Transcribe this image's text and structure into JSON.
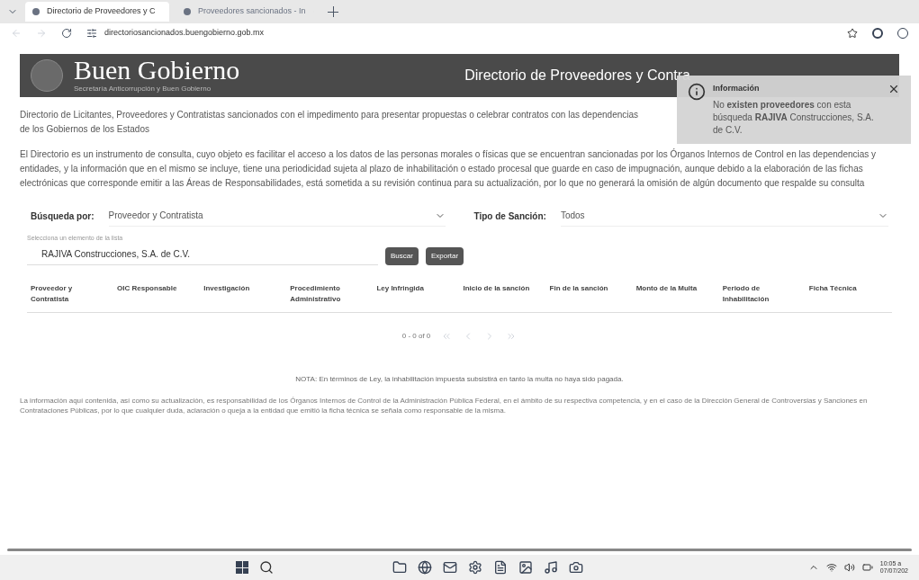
{
  "browser": {
    "tabs": [
      {
        "label": "Directorio de Proveedores y C",
        "selected": true
      },
      {
        "label": "Proveedores sancionados - In",
        "selected": false
      }
    ],
    "url": "directoriosancionados.buengobierno.gob.mx"
  },
  "header": {
    "logo": "Buen Gobierno",
    "subtitle": "Secretaría Anticorrupción y Buen Gobierno",
    "title": "Directorio de Proveedores y Contra"
  },
  "toast": {
    "title": "Información",
    "message": "No **existen proveedores** con esta búsqueda **RAJIVA** Construcciones, S.A. de C.V."
  },
  "intro_lead": [
    "Directorio de Licitantes, Proveedores y Contratistas sancionados con el impedimento para presentar propuestas o celebrar contratos con las dependencias",
    "de los Gobiernos de los Estados"
  ],
  "intro": [
    "El Directorio es un instrumento de consulta, cuyo objeto es facilitar el acceso a los datos de las personas morales o físicas que se encuentran sancionadas por los Órganos Internos de Control en las dependencias y entidades, y la información que en el mismo se incluye, tiene una periodicidad sujeta al plazo de inhabilitación o estado procesal que guarde en caso de impugnación, aunque debido a la elaboración de las fichas electrónicas que corresponde emitir a las Áreas de Responsabilidades, está sometida a su revisión continua para su actualización, por lo que no generará la omisión de algún documento que respalde su consulta"
  ],
  "filters": [
    {
      "label": "Búsqueda por:",
      "value": "Proveedor y Contratista"
    },
    {
      "label": "Tipo de Sanción:",
      "value": "Todos"
    }
  ],
  "search": {
    "label": "Selecciona un elemento de la lista",
    "value": "RAJIVA Construcciones, S.A. de C.V.",
    "buttons": [
      "Buscar",
      "Exportar"
    ]
  },
  "table": {
    "columns": [
      "Proveedor y Contratista",
      "OIC Responsable",
      "Investigación",
      "Procedimiento Administrativo",
      "Ley Infringida",
      "Inicio de la sanción",
      "Fin de la sanción",
      "Monto de la Multa",
      "Periodo de Inhabilitación",
      "Ficha Técnica"
    ]
  },
  "pagination": {
    "range": "0 - 0 of 0"
  },
  "note": "NOTA: En términos de Ley, la inhabilitación impuesta subsistirá en tanto la multa no haya sido pagada.",
  "disclaimer": "La información aquí contenida, así como su actualización, es responsabilidad de los Órganos Internos de Control de la Administración Pública Federal, en el ámbito de su respectiva competencia, y en el caso de la Dirección General de Controversias y Sanciones en Contrataciones Públicas, por lo que cualquier duda, aclaración o queja a la entidad que emitió la ficha técnica se señala como responsable de la misma.",
  "taskbar": {
    "time": "10:05 a",
    "date": "07/07/202"
  }
}
